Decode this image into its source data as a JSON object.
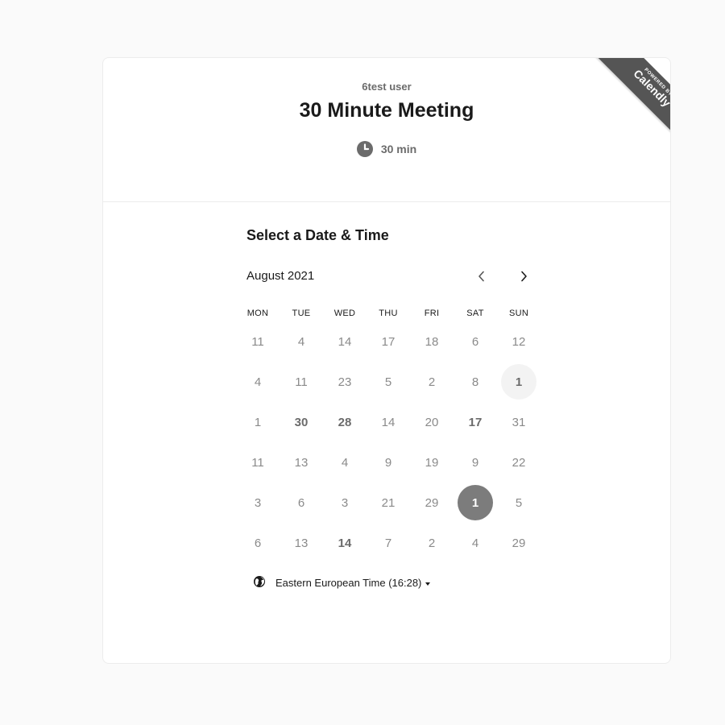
{
  "event": {
    "host": "6test user",
    "title": "30 Minute Meeting",
    "duration": "30 min",
    "duration_icon": "clock-icon"
  },
  "branding": {
    "line1": "POWERED BY",
    "line2": "Calendly"
  },
  "picker": {
    "heading": "Select a Date & Time",
    "month": "August 2021",
    "prev_icon": "chevron-left-icon",
    "next_icon": "chevron-right-icon",
    "weekdays": [
      "MON",
      "TUE",
      "WED",
      "THU",
      "FRI",
      "SAT",
      "SUN"
    ],
    "rows": [
      [
        {
          "t": "11",
          "s": "normal"
        },
        {
          "t": "4",
          "s": "normal"
        },
        {
          "t": "14",
          "s": "normal"
        },
        {
          "t": "17",
          "s": "normal"
        },
        {
          "t": "18",
          "s": "normal"
        },
        {
          "t": "6",
          "s": "normal"
        },
        {
          "t": "12",
          "s": "normal"
        }
      ],
      [
        {
          "t": "4",
          "s": "normal"
        },
        {
          "t": "11",
          "s": "normal"
        },
        {
          "t": "23",
          "s": "normal"
        },
        {
          "t": "5",
          "s": "normal"
        },
        {
          "t": "2",
          "s": "normal"
        },
        {
          "t": "8",
          "s": "normal"
        },
        {
          "t": "1",
          "s": "light"
        }
      ],
      [
        {
          "t": "1",
          "s": "normal"
        },
        {
          "t": "30",
          "s": "bold"
        },
        {
          "t": "28",
          "s": "bold"
        },
        {
          "t": "14",
          "s": "normal"
        },
        {
          "t": "20",
          "s": "normal"
        },
        {
          "t": "17",
          "s": "bold"
        },
        {
          "t": "31",
          "s": "normal"
        }
      ],
      [
        {
          "t": "11",
          "s": "normal"
        },
        {
          "t": "13",
          "s": "normal"
        },
        {
          "t": "4",
          "s": "normal"
        },
        {
          "t": "9",
          "s": "normal"
        },
        {
          "t": "19",
          "s": "normal"
        },
        {
          "t": "9",
          "s": "normal"
        },
        {
          "t": "22",
          "s": "normal"
        }
      ],
      [
        {
          "t": "3",
          "s": "normal"
        },
        {
          "t": "6",
          "s": "normal"
        },
        {
          "t": "3",
          "s": "normal"
        },
        {
          "t": "21",
          "s": "normal"
        },
        {
          "t": "29",
          "s": "normal"
        },
        {
          "t": "1",
          "s": "selected"
        },
        {
          "t": "5",
          "s": "normal"
        }
      ],
      [
        {
          "t": "6",
          "s": "normal"
        },
        {
          "t": "13",
          "s": "normal"
        },
        {
          "t": "14",
          "s": "bold"
        },
        {
          "t": "7",
          "s": "normal"
        },
        {
          "t": "2",
          "s": "normal"
        },
        {
          "t": "4",
          "s": "normal"
        },
        {
          "t": "29",
          "s": "normal"
        }
      ]
    ]
  },
  "timezone": {
    "label": "Eastern European Time (16:28)",
    "icon": "globe-icon"
  },
  "colors": {
    "page_bg": "#fafafa",
    "card_bg": "#ffffff",
    "selected_day": "#7c7c7c",
    "ribbon": "#555555"
  }
}
